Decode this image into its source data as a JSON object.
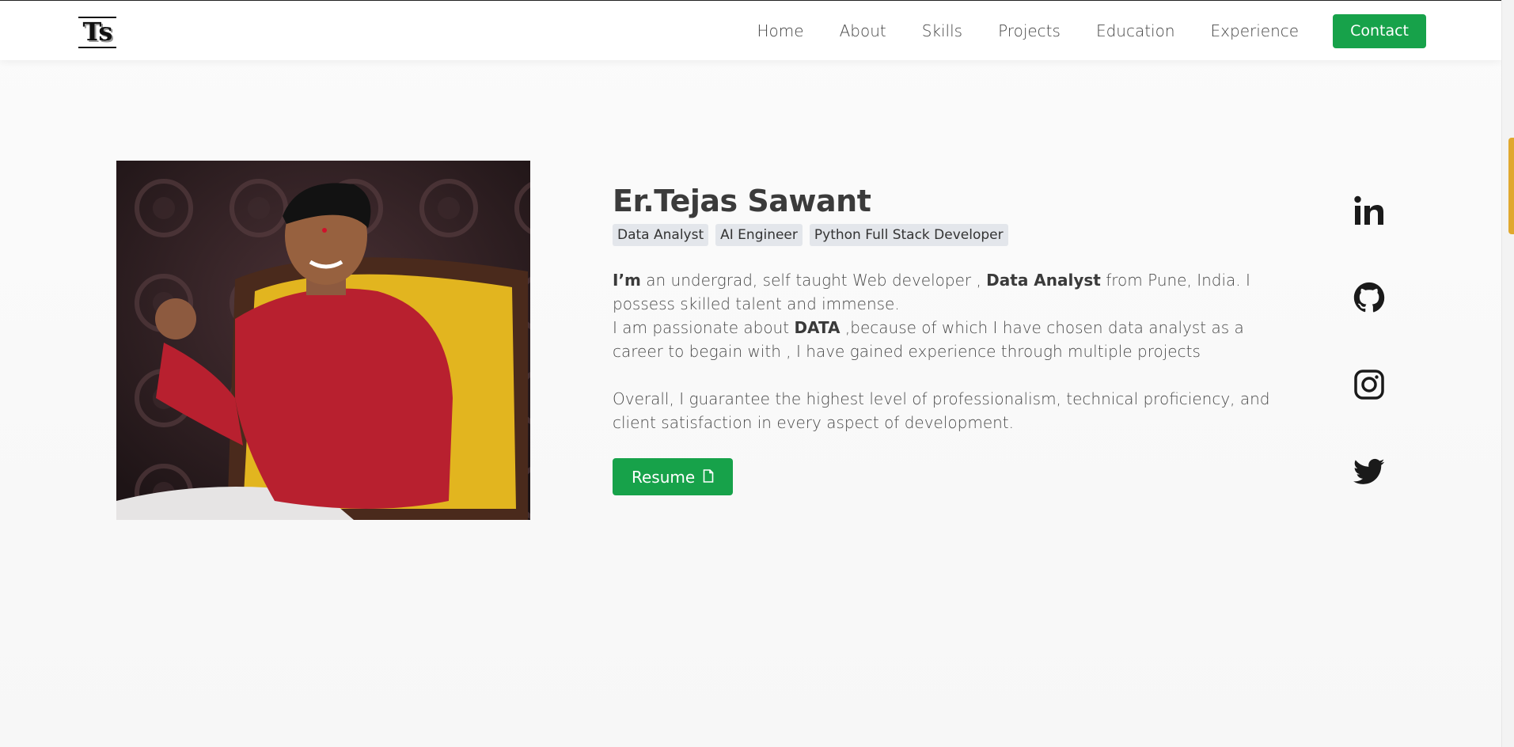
{
  "header": {
    "logo_text": "Ts",
    "nav": [
      {
        "label": "Home"
      },
      {
        "label": "About"
      },
      {
        "label": "Skills"
      },
      {
        "label": "Projects"
      },
      {
        "label": "Education"
      },
      {
        "label": "Experience"
      }
    ],
    "contact_label": "Contact"
  },
  "hero": {
    "name": "Er.Tejas Sawant",
    "tags": [
      "Data Analyst",
      "AI Engineer",
      "Python Full Stack Developer"
    ],
    "bio": {
      "p1_lead_bold": "I’m",
      "p1_text1": " an undergrad, self taught Web developer , ",
      "p1_bold2": "Data Analyst",
      "p1_text2": " from Pune, India. I possess skilled talent and immense.",
      "p2_text1": "I am passionate about ",
      "p2_bold": "DATA",
      "p2_text2": " ,because of which I have chosen data analyst as a career to begain with , I have gained experience through multiple projects",
      "p3_text": "Overall, I guarantee the highest level of professionalism, technical proficiency, and client satisfaction in every aspect of development."
    },
    "resume_label": "Resume"
  },
  "socials": [
    {
      "icon": "linkedin-icon"
    },
    {
      "icon": "github-icon"
    },
    {
      "icon": "instagram-icon"
    },
    {
      "icon": "twitter-icon"
    }
  ],
  "colors": {
    "accent_green": "#17a24a",
    "tag_bg": "#e3e6eb",
    "scroll_thumb": "#e0a82e"
  }
}
